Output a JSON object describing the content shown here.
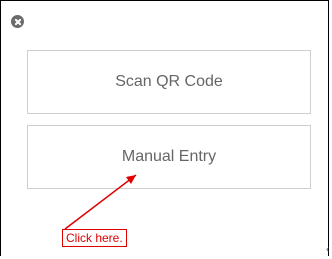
{
  "dialog": {
    "close_icon": "close-circle-icon",
    "options": {
      "scan_label": "Scan QR Code",
      "manual_label": "Manual Entry"
    }
  },
  "annotation": {
    "callout_text": "Click here.",
    "color": "#e00000"
  },
  "edge_glyph": "‹"
}
